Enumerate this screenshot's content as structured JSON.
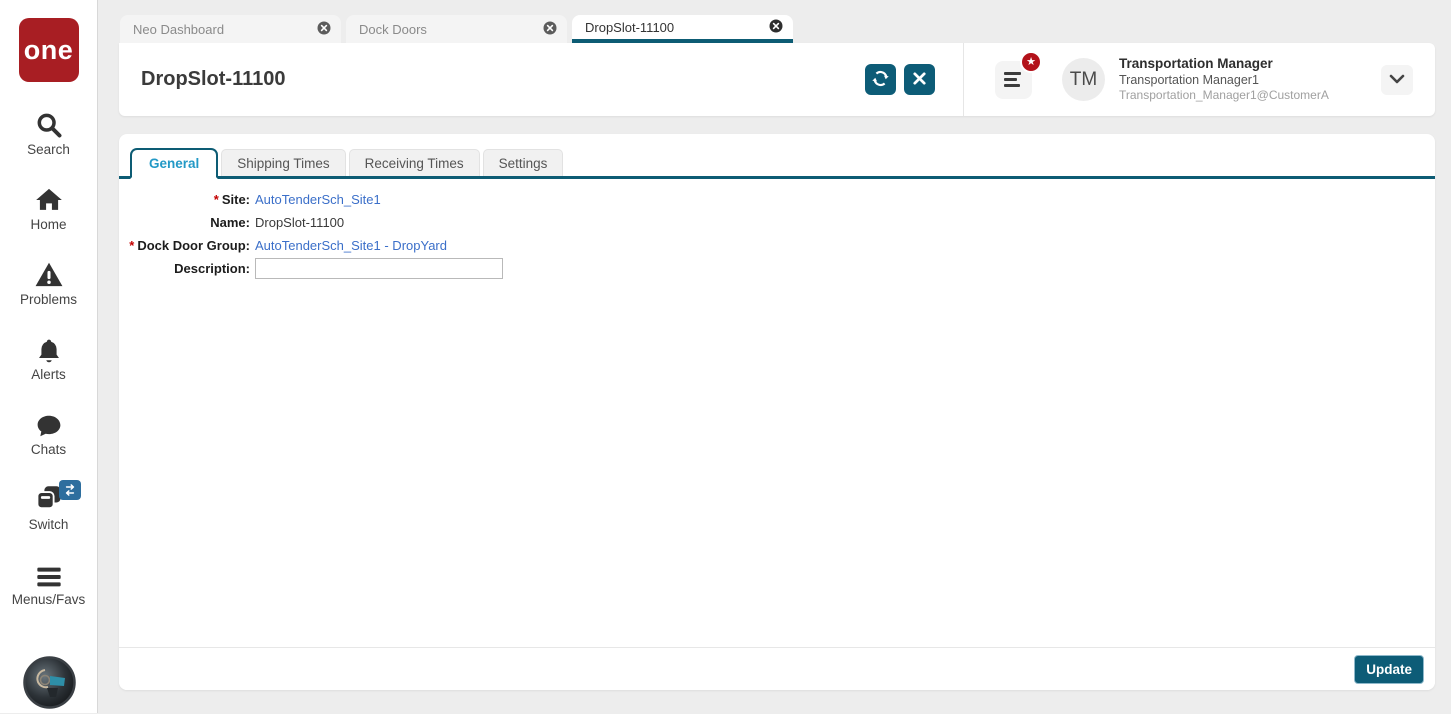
{
  "brand": {
    "logo_text": "one"
  },
  "sidebar": {
    "items": [
      {
        "id": "search",
        "label": "Search"
      },
      {
        "id": "home",
        "label": "Home"
      },
      {
        "id": "problems",
        "label": "Problems"
      },
      {
        "id": "alerts",
        "label": "Alerts"
      },
      {
        "id": "chats",
        "label": "Chats"
      },
      {
        "id": "switch",
        "label": "Switch"
      },
      {
        "id": "menus",
        "label": "Menus/Favs"
      }
    ]
  },
  "window_tabs": [
    {
      "label": "Neo Dashboard",
      "active": false
    },
    {
      "label": "Dock Doors",
      "active": false
    },
    {
      "label": "DropSlot-11100",
      "active": true
    }
  ],
  "header": {
    "title": "DropSlot-11100",
    "user": {
      "initials": "TM",
      "role": "Transportation Manager",
      "username": "Transportation Manager1",
      "account": "Transportation_Manager1@CustomerA"
    }
  },
  "detail_tabs": [
    {
      "label": "General",
      "active": true
    },
    {
      "label": "Shipping Times",
      "active": false
    },
    {
      "label": "Receiving Times",
      "active": false
    },
    {
      "label": "Settings",
      "active": false
    }
  ],
  "form": {
    "required_marker": "*",
    "fields": [
      {
        "label": "Site:",
        "required": true,
        "value": "AutoTenderSch_Site1",
        "kind": "link"
      },
      {
        "label": "Name:",
        "required": false,
        "value": "DropSlot-11100",
        "kind": "text"
      },
      {
        "label": "Dock Door Group:",
        "required": true,
        "value": "AutoTenderSch_Site1 - DropYard",
        "kind": "link"
      },
      {
        "label": "Description:",
        "required": false,
        "value": "",
        "kind": "input"
      }
    ]
  },
  "footer": {
    "update_label": "Update"
  },
  "badges": {
    "star_glyph": "★"
  },
  "colors": {
    "accent_teal": "#0d5c77",
    "brand_red": "#a81e23",
    "badge_red": "#b3121a",
    "link_blue": "#3b6fc9",
    "active_tab_text": "#2399c6",
    "switch_badge_blue": "#2d6e9e"
  }
}
